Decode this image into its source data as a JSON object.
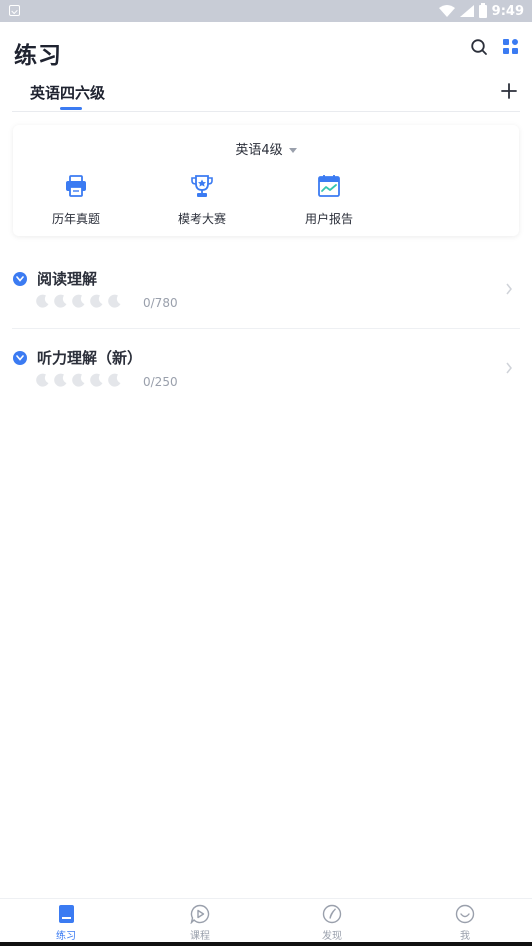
{
  "status_bar": {
    "time": "9:49"
  },
  "header": {
    "title": "练习"
  },
  "tabs": [
    {
      "label": "英语四六级",
      "active": true
    }
  ],
  "card": {
    "level_selector": "英语4级",
    "features": [
      {
        "label": "历年真题",
        "icon": "printer-icon"
      },
      {
        "label": "模考大赛",
        "icon": "trophy-icon"
      },
      {
        "label": "用户报告",
        "icon": "report-chart-icon"
      }
    ]
  },
  "sections": [
    {
      "title": "阅读理解",
      "progress": "0/780",
      "stars_total": 5,
      "stars_filled": 0
    },
    {
      "title": "听力理解（新）",
      "progress": "0/250",
      "stars_total": 5,
      "stars_filled": 0
    }
  ],
  "bottom_nav": [
    {
      "label": "练习",
      "icon": "book-icon",
      "active": true
    },
    {
      "label": "课程",
      "icon": "play-bubble-icon",
      "active": false
    },
    {
      "label": "发现",
      "icon": "compass-icon",
      "active": false
    },
    {
      "label": "我",
      "icon": "smile-icon",
      "active": false
    }
  ],
  "colors": {
    "accent": "#3b7bf2",
    "text": "#2b2f3a",
    "muted": "#9aa0ac",
    "status_bar": "#c8ccd6"
  }
}
